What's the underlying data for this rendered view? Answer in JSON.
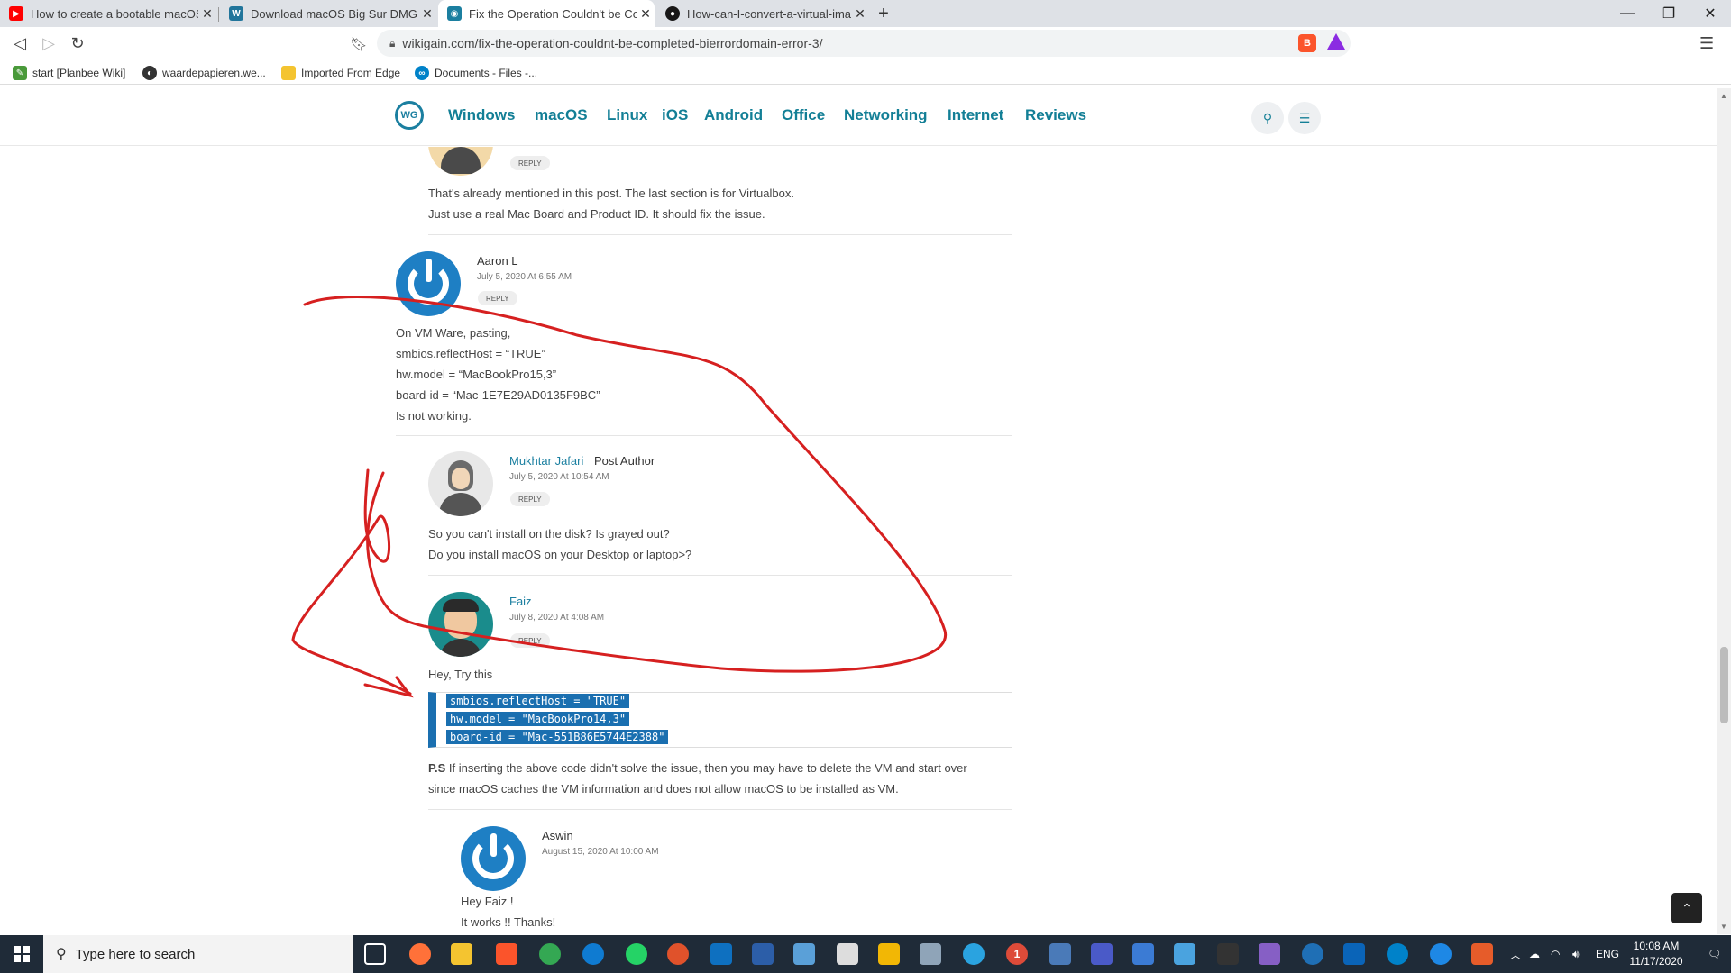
{
  "browser": {
    "tabs": [
      {
        "title": "How to create a bootable macOS ",
        "icon": "youtube-icon",
        "color": "#ff0000"
      },
      {
        "title": "Download macOS Big Sur DMG Fil",
        "icon": "wordpress-icon",
        "color": "#21759b"
      },
      {
        "title": "Fix the Operation Couldn't be Com",
        "icon": "globe-icon",
        "color": "#1b7fa0"
      },
      {
        "title": "How-can-I-convert-a-virtual-imag",
        "icon": "github-icon",
        "color": "#181717"
      }
    ],
    "url": "wikigain.com/fix-the-operation-couldnt-be-completed-bierrordomain-error-3/",
    "bookmarks": [
      "start [Planbee Wiki]",
      "waardepapieren.we...",
      "Imported From Edge",
      "Documents - Files -..."
    ]
  },
  "site": {
    "logo_text": "WG",
    "nav": [
      "Windows",
      "macOS",
      "Linux",
      "iOS",
      "Android",
      "Office",
      "Networking",
      "Internet",
      "Reviews"
    ]
  },
  "comments": {
    "c0": {
      "reply": "REPLY",
      "lines": [
        "That's already mentioned in this post. The last section is for Virtualbox.",
        "Just use a real Mac Board and Product ID. It should fix the issue."
      ]
    },
    "c1": {
      "author": "Aaron L",
      "date": "July 5, 2020 At 6:55 AM",
      "reply": "REPLY",
      "lines": [
        "On VM Ware, pasting,",
        "smbios.reflectHost = “TRUE”",
        "hw.model = “MacBookPro15,3”",
        "board-id = “Mac-1E7E29AD0135F9BC”",
        "Is not working."
      ]
    },
    "c2": {
      "author": "Mukhtar Jafari",
      "badge": "Post Author",
      "date": "July 5, 2020 At 10:54 AM",
      "reply": "REPLY",
      "lines": [
        "So you can't install on the disk? Is grayed out?",
        "Do you install macOS on your Desktop or laptop>?"
      ]
    },
    "c3": {
      "author": "Faiz",
      "date": "July 8, 2020 At 4:08 AM",
      "reply": "REPLY",
      "intro": "Hey, Try this",
      "code": [
        "smbios.reflectHost = \"TRUE\"",
        "hw.model = \"MacBookPro14,3\"",
        "board-id = \"Mac-551B86E5744E2388\""
      ],
      "ps_label": "P.S",
      "ps_line1": "If inserting the above code didn't solve the issue, then you may have to delete the VM and start over",
      "ps_line2": "since macOS caches the VM information and does not allow macOS to be installed as VM."
    },
    "c4": {
      "author": "Aswin",
      "date": "August 15, 2020 At 10:00 AM",
      "lines": [
        "Hey Faiz !",
        "It works !! Thanks!"
      ]
    }
  },
  "taskbar": {
    "search_placeholder": "Type here to search",
    "lang": "ENG",
    "time": "10:08 AM",
    "date": "11/17/2020",
    "badge": "1"
  },
  "colors": {
    "accent": "#137f96",
    "annotation": "#d62020",
    "code_highlight": "#1a6fb0"
  }
}
